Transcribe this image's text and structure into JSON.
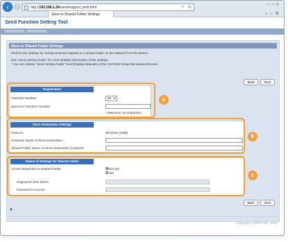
{
  "browser": {
    "url_prefix": "http://",
    "url_host": "192.168.1.24",
    "url_path": "/send/support_smb.html",
    "tab_title": "Store to Shared Folder Settings",
    "search_icon": "search-icon",
    "refresh_icon": "refresh-icon"
  },
  "app": {
    "title": "Send Function Setting Tool"
  },
  "panel": {
    "header": "Store to Shared Folder Settings",
    "intro_line1": "Perform the settings for storing scanned originals to a shared folder on the network from the device.",
    "intro_line2": "See \"Send Setting Guide\" for more detailed information of the settings.",
    "intro_line3": "* You can display \"Send Setting Guide\" from [Display Manuals] of the CD-ROM Setup that started this tool."
  },
  "buttons": {
    "back": "Back",
    "next": "Next"
  },
  "registration": {
    "title": "Registration",
    "favorites_label": "Favorites Number:",
    "favorites_value": "02",
    "name_label": "Name for Favorites Number:",
    "name_value": "",
    "max_hint": "* Maximum 16 Characters"
  },
  "destination": {
    "title": "Store Destination Settings",
    "protocol_label": "Protocol:",
    "protocol_value": "Windows (SMB)",
    "computer_label": "Computer Name of Store Destination:",
    "computer_value": "",
    "folder_label": "Shared Folder Name on Store Destination Computer:",
    "folder_value": ""
  },
  "status": {
    "title": "Status of Settings for Shared Folder",
    "access_label": "Access Restriction to Shared Folder:",
    "option_not_set": "Not Set",
    "option_set": "Set",
    "user_label": "Registered User Name:",
    "password_label": "Password to Access:"
  },
  "badges": {
    "a": "a",
    "b": "b",
    "c": "c"
  },
  "footer": {
    "top_arrow": "▲",
    "copyright": "Copyright CANON INC. 2015"
  },
  "colors": {
    "accent": "#3f6eb5",
    "callout": "#f0a03c",
    "panel_bg": "#dbe4ee"
  }
}
